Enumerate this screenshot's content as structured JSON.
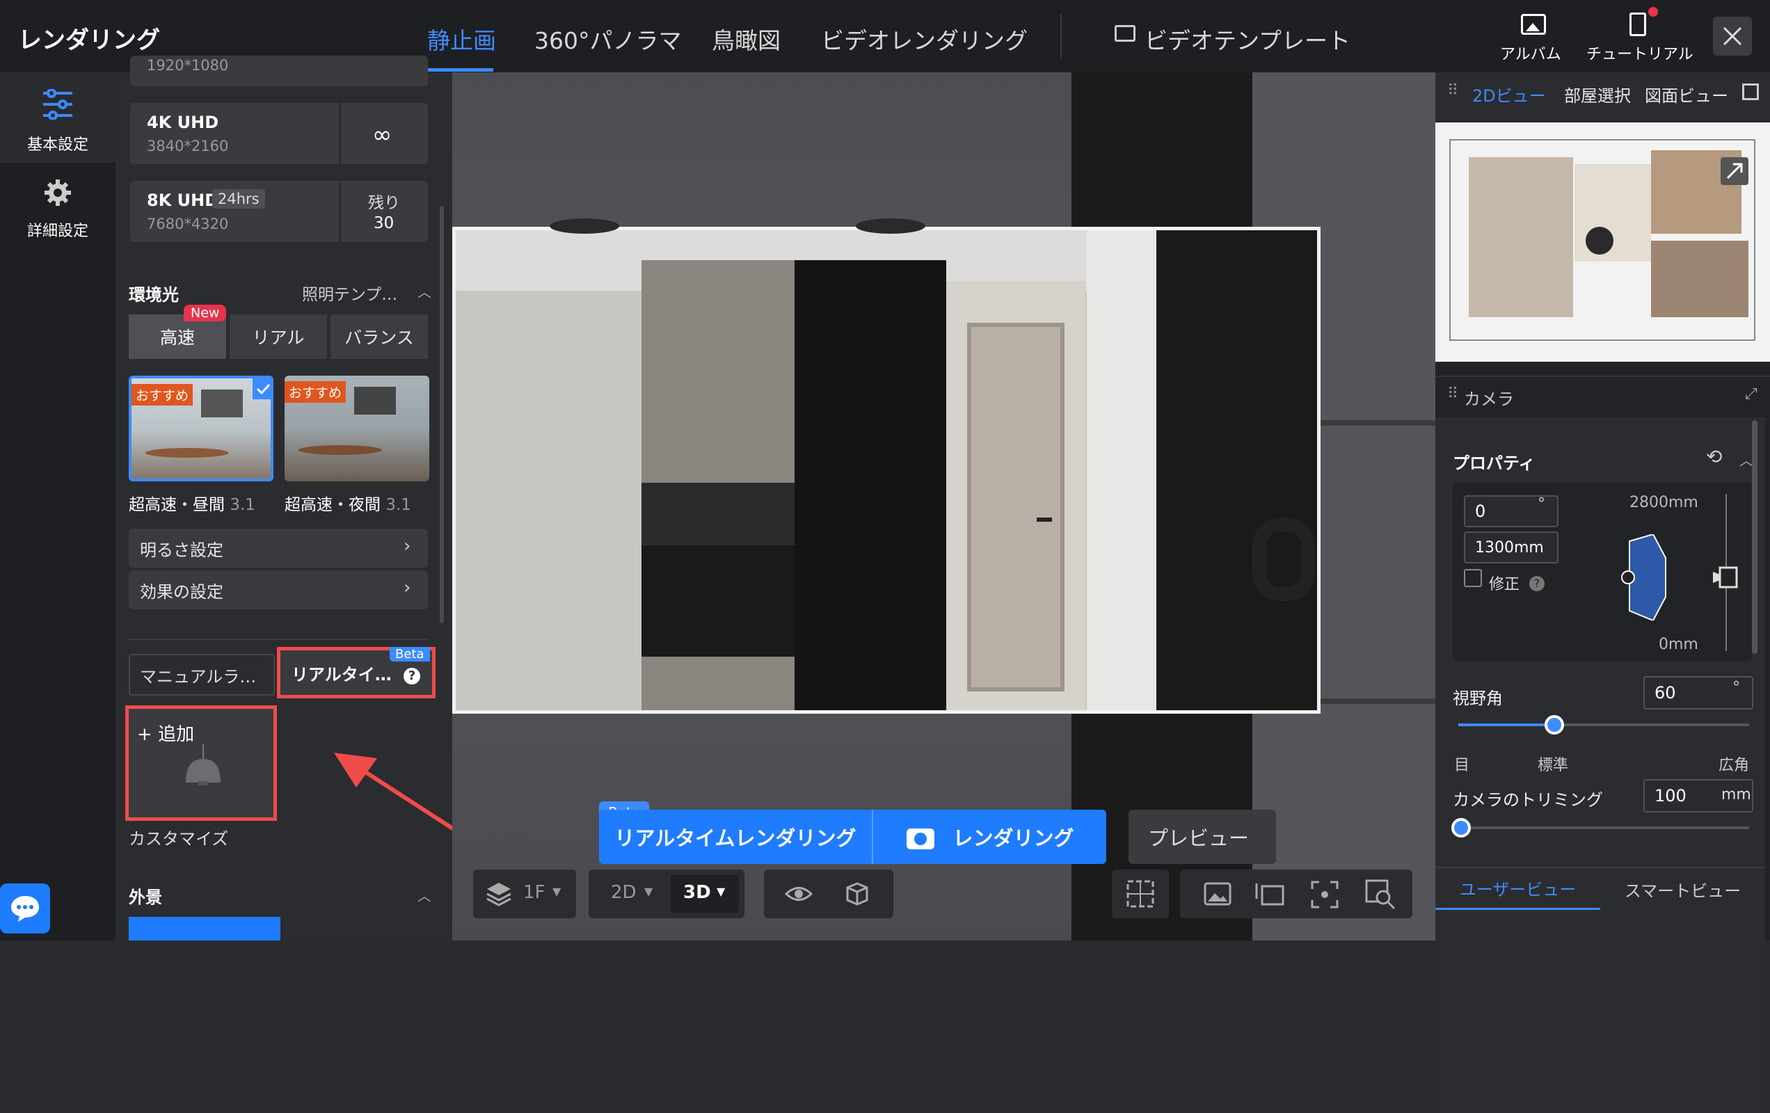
{
  "header": {
    "title": "レンダリング",
    "tabs": [
      "静止画",
      "360°パノラマ",
      "鳥瞰図",
      "ビデオレンダリング"
    ],
    "video_template": "ビデオテンプレート",
    "album": "アルバム",
    "tutorial": "チュートリアル"
  },
  "leftnav": {
    "basic": "基本設定",
    "advanced": "詳細設定"
  },
  "resolution": {
    "cut_label": "1920*1080",
    "r4k_title": "4K UHD",
    "r4k_sub": "3840*2160",
    "r8k_title": "8K UHD",
    "r8k_badge": "24hrs",
    "r8k_sub": "7680*4320",
    "remain_label": "残り",
    "remain_value": "30"
  },
  "env": {
    "title": "環境光",
    "template": "照明テンプ…",
    "modes": [
      "高速",
      "リアル",
      "バランス"
    ],
    "new_badge": "New",
    "presets": [
      {
        "badge": "おすすめ",
        "label": "超高速・昼間",
        "ver": "3.1"
      },
      {
        "badge": "おすすめ",
        "label": "超高速・夜間",
        "ver": "3.1"
      }
    ],
    "brightness": "明るさ設定",
    "effects": "効果の設定"
  },
  "lighting": {
    "manual": "マニュアルラ…",
    "realtime": "リアルタイ…",
    "beta": "Beta",
    "add": "追加",
    "custom_label": "カスタマイズ"
  },
  "exterior": {
    "title": "外景"
  },
  "bottom": {
    "beta": "Beta",
    "realtime_render": "リアルタイムレンダリング",
    "render": "レンダリング",
    "preview": "プレビュー",
    "floor": "1F",
    "mode2d": "2D",
    "mode3d": "3D"
  },
  "right": {
    "tabs": [
      "2Dビュー",
      "部屋選択",
      "図面ビュー"
    ],
    "camera_title": "カメラ",
    "properties": "プロパティ",
    "angle": "0",
    "angle_unit": "°",
    "height": "1300mm",
    "correct": "修正",
    "max_h": "2800mm",
    "min_h": "0mm",
    "fov_label": "視野角",
    "fov_value": "60",
    "fov_unit": "°",
    "fov_marks": [
      "目",
      "標準",
      "広角"
    ],
    "fov_fraction": 0.33,
    "trim_label": "カメラのトリミング",
    "trim_value": "100",
    "trim_unit": "mm",
    "trim_fraction": 0.0,
    "view_tabs": [
      "ユーザービュー",
      "スマートビュー"
    ]
  },
  "colors": {
    "accent": "#1f7cff",
    "active_tab": "#3d8bff",
    "highlight": "#f04b4b",
    "badge_orange": "#e0561e",
    "badge_red": "#e8334a"
  }
}
